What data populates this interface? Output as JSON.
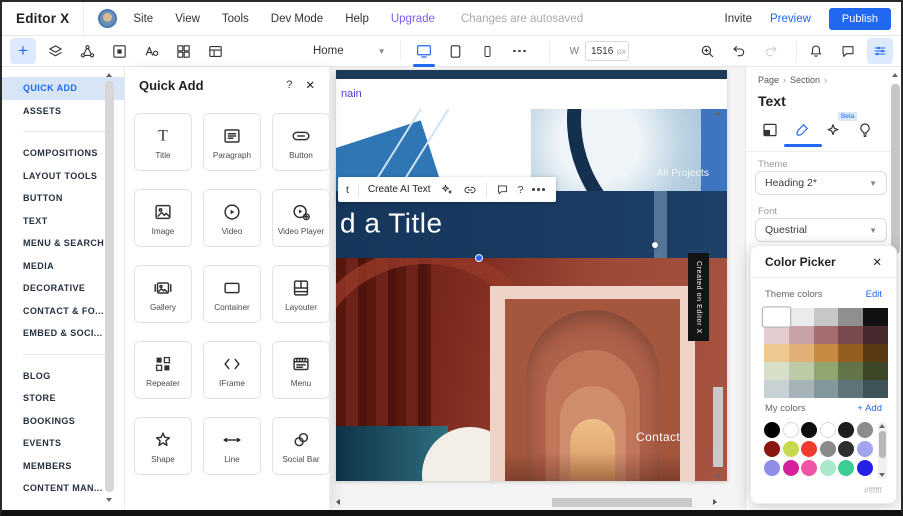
{
  "app": {
    "accent_color": "#2168f0",
    "upgrade_color": "#7b5cf5"
  },
  "menubar": {
    "logo": "Editor X",
    "menu_items": [
      "Site",
      "View",
      "Tools",
      "Dev Mode",
      "Help"
    ],
    "upgrade_label": "Upgrade",
    "autosave_status": "Changes are autosaved",
    "invite_label": "Invite",
    "preview_label": "Preview",
    "publish_label": "Publish"
  },
  "toolbar": {
    "page_selector_value": "Home",
    "width_label": "W",
    "width_value": "1516",
    "width_unit": "px"
  },
  "sidebar": {
    "active_item": "QUICK ADD",
    "groups": [
      {
        "items": [
          "QUICK ADD",
          "ASSETS"
        ]
      },
      {
        "items": [
          "COMPOSITIONS",
          "LAYOUT TOOLS",
          "BUTTON",
          "TEXT",
          "MENU & SEARCH",
          "MEDIA",
          "DECORATIVE",
          "CONTACT & FO...",
          "EMBED & SOCI..."
        ]
      },
      {
        "items": [
          "BLOG",
          "STORE",
          "BOOKINGS",
          "EVENTS",
          "MEMBERS",
          "CONTENT MAN..."
        ]
      }
    ]
  },
  "quick_add": {
    "title": "Quick Add",
    "help_label": "?",
    "close_label": "✕",
    "items": [
      {
        "label": "Title",
        "icon": "title-icon"
      },
      {
        "label": "Paragraph",
        "icon": "paragraph-icon"
      },
      {
        "label": "Button",
        "icon": "button-icon"
      },
      {
        "label": "Image",
        "icon": "image-icon"
      },
      {
        "label": "Video",
        "icon": "video-icon"
      },
      {
        "label": "Video Player",
        "icon": "video-player-icon"
      },
      {
        "label": "Gallery",
        "icon": "gallery-icon"
      },
      {
        "label": "Container",
        "icon": "container-icon"
      },
      {
        "label": "Layouter",
        "icon": "layouter-icon"
      },
      {
        "label": "Repeater",
        "icon": "repeater-icon"
      },
      {
        "label": "IFrame",
        "icon": "iframe-icon"
      },
      {
        "label": "Menu",
        "icon": "menu-icon"
      },
      {
        "label": "Shape",
        "icon": "shape-icon"
      },
      {
        "label": "Line",
        "icon": "line-icon"
      },
      {
        "label": "Social Bar",
        "icon": "social-bar-icon"
      }
    ]
  },
  "canvas": {
    "domain_link_fragment": "nain",
    "hero_label": "All Projects",
    "selection_toolbar": {
      "left_fragment": "t",
      "create_ai_text_label": "Create AI Text",
      "help_label": "?"
    },
    "title_fragment": "d a Title",
    "contact_label": "Contact",
    "badge_vertical_text": "Created on Editor X"
  },
  "inspector": {
    "breadcrumb": [
      "Page",
      "Section"
    ],
    "breadcrumb_separator": "›",
    "panel_title": "Text",
    "beta_badge": "Beta",
    "theme_label": "Theme",
    "theme_value": "Heading 2*",
    "font_label": "Font",
    "font_value": "Questrial"
  },
  "color_picker": {
    "title": "Color Picker",
    "close_label": "✕",
    "theme_colors_label": "Theme colors",
    "edit_label": "Edit",
    "selected_index": 0,
    "theme_colors": [
      [
        "#ffffff",
        "#ebebeb",
        "#c7c7c7",
        "#8f8f8f",
        "#101010"
      ],
      [
        "#e3cdd0",
        "#c9a2a8",
        "#a76e72",
        "#7b4a4e",
        "#462a2e"
      ],
      [
        "#eec88f",
        "#dfb176",
        "#c78a41",
        "#955e20",
        "#5a3a12"
      ],
      [
        "#d8dfc9",
        "#bccaa6",
        "#90a56f",
        "#64744a",
        "#3c4727"
      ],
      [
        "#c8d1d4",
        "#a6b4b9",
        "#83969c",
        "#5f747a",
        "#40525a"
      ]
    ],
    "my_colors_label": "My colors",
    "add_label": "+ Add",
    "my_colors": [
      [
        "#000000",
        "#ffffff",
        "#0d0d0d",
        "#ffffff",
        "#1c1c1c",
        "#8c8c8c"
      ],
      [
        "#8c1612",
        "#c9d94e",
        "#f03c2e",
        "#8a8a8a",
        "#2e2e2e",
        "#a3a4ee"
      ],
      [
        "#8f8cea",
        "#d6219c",
        "#ee55a6",
        "#a9e9c9",
        "#3bcd92",
        "#2323e8"
      ]
    ],
    "hex_value": "#ffffff"
  }
}
